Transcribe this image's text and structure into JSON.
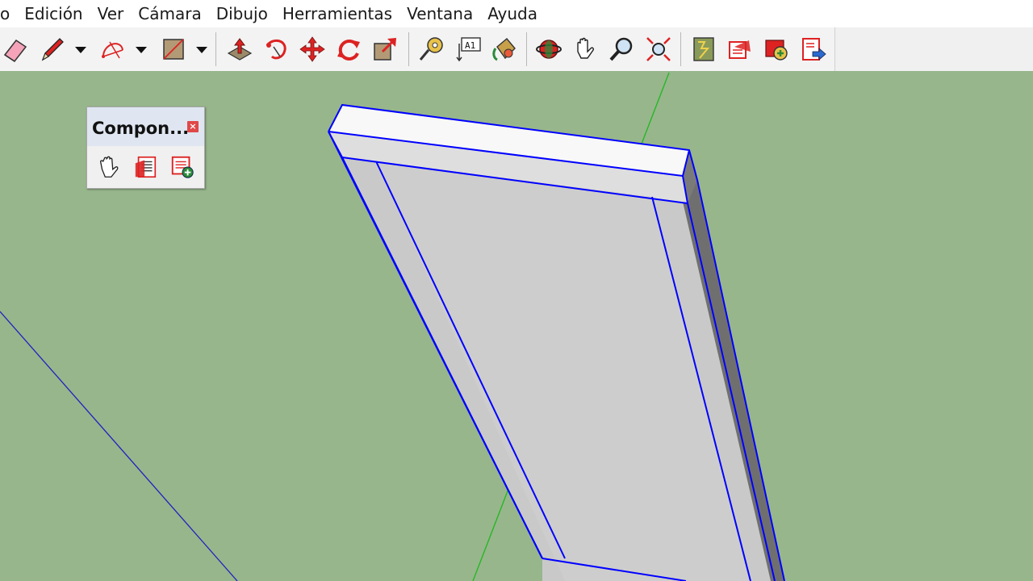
{
  "menubar": {
    "items": [
      "o",
      "Edición",
      "Ver",
      "Cámara",
      "Dibujo",
      "Herramientas",
      "Ventana",
      "Ayuda"
    ]
  },
  "toolbar": {
    "tools": [
      "eraser-icon",
      "pencil-icon",
      "arc-icon",
      "rectangle-icon",
      "push-pull-icon",
      "follow-me-icon",
      "move-icon",
      "rotate-icon",
      "scale-icon",
      "tape-measure-icon",
      "text-icon",
      "paint-bucket-icon",
      "orbit-icon",
      "pan-icon",
      "zoom-icon",
      "zoom-extents-icon",
      "warehouse-icon",
      "share-model-icon",
      "get-models-icon",
      "export-icon"
    ]
  },
  "components_panel": {
    "title": "Compon...",
    "close_label": "×",
    "tools": [
      "interact-icon",
      "component-options-icon",
      "component-attributes-icon"
    ]
  },
  "colors": {
    "ground": "#97b68c",
    "selection": "#0000ff",
    "face": "#c9c9c9",
    "green_axis": "#1db81d",
    "blue_axis": "#2020c0"
  }
}
